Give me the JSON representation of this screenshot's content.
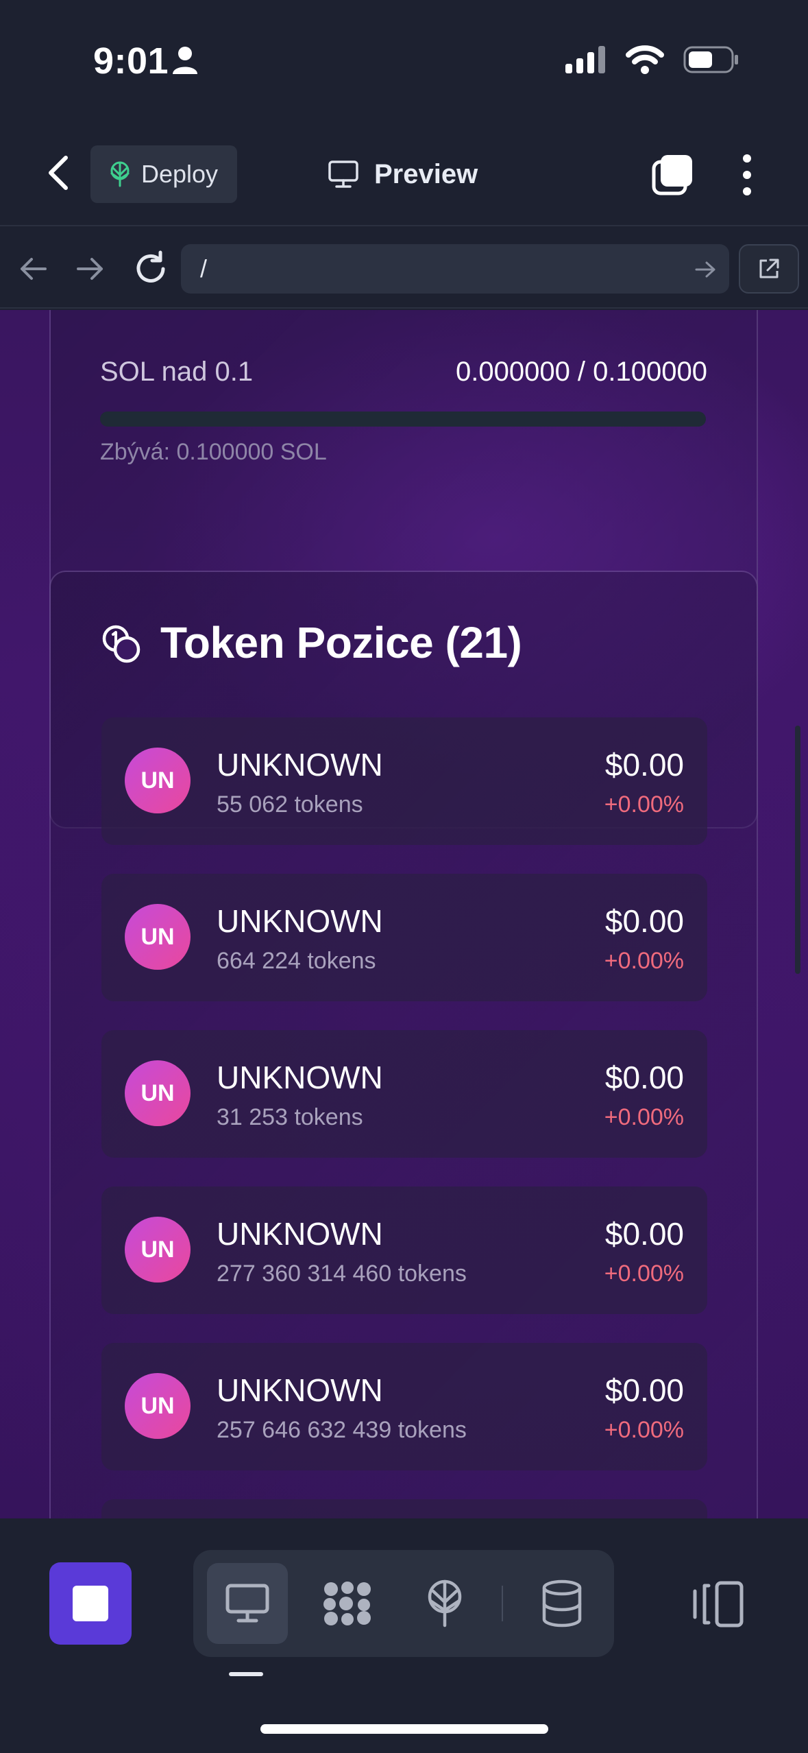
{
  "status_bar": {
    "time": "9:01"
  },
  "header": {
    "deploy_label": "Deploy",
    "preview_label": "Preview"
  },
  "browser": {
    "url": "/"
  },
  "sol_card": {
    "label": "SOL nad 0.1",
    "value": "0.000000 / 0.100000",
    "progress_fraction": 0.0,
    "remaining": "Zbývá: 0.100000 SOL"
  },
  "tokens": {
    "title": "Token Pozice (21)",
    "items": [
      {
        "initials": "UN",
        "name": "UNKNOWN",
        "amount": "55 062 tokens",
        "value": "$0.00",
        "change": "+0.00%"
      },
      {
        "initials": "UN",
        "name": "UNKNOWN",
        "amount": "664 224 tokens",
        "value": "$0.00",
        "change": "+0.00%"
      },
      {
        "initials": "UN",
        "name": "UNKNOWN",
        "amount": "31 253 tokens",
        "value": "$0.00",
        "change": "+0.00%"
      },
      {
        "initials": "UN",
        "name": "UNKNOWN",
        "amount": "277 360 314 460 tokens",
        "value": "$0.00",
        "change": "+0.00%"
      },
      {
        "initials": "UN",
        "name": "UNKNOWN",
        "amount": "257 646 632 439 tokens",
        "value": "$0.00",
        "change": "+0.00%"
      }
    ]
  },
  "toolbar": {
    "icons": [
      "stop-icon",
      "monitor-icon",
      "dots-grid-icon",
      "deploy-tree-icon",
      "database-icon",
      "split-view-icon"
    ]
  },
  "colors": {
    "accent": "#5a3ad8",
    "negative": "#f06b7d",
    "background": "#1d2130",
    "content_purple": "#40176a"
  }
}
